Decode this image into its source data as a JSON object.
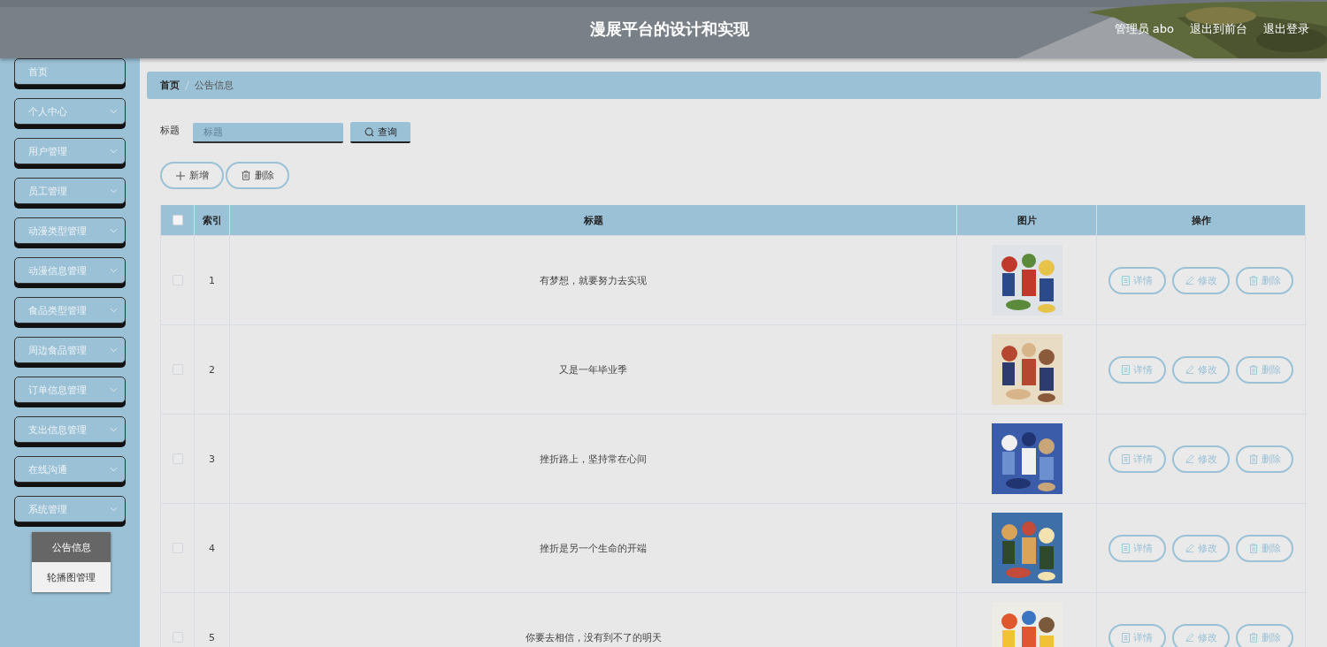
{
  "header": {
    "title": "漫展平台的设计和实现",
    "links": [
      "管理员 abo",
      "退出到前台",
      "退出登录"
    ]
  },
  "sidebar": {
    "items": [
      {
        "label": "首页",
        "kind": "link"
      },
      {
        "label": "个人中心",
        "kind": "group"
      },
      {
        "label": "用户管理",
        "kind": "group"
      },
      {
        "label": "员工管理",
        "kind": "group"
      },
      {
        "label": "动漫类型管理",
        "kind": "group"
      },
      {
        "label": "动漫信息管理",
        "kind": "group"
      },
      {
        "label": "食品类型管理",
        "kind": "group"
      },
      {
        "label": "周边食品管理",
        "kind": "group"
      },
      {
        "label": "订单信息管理",
        "kind": "group"
      },
      {
        "label": "支出信息管理",
        "kind": "group"
      },
      {
        "label": "在线沟通",
        "kind": "group"
      },
      {
        "label": "系统管理",
        "kind": "group",
        "children": [
          {
            "label": "公告信息",
            "selected": true
          },
          {
            "label": "轮播图管理",
            "selected": false
          }
        ]
      }
    ]
  },
  "breadcrumb": [
    "首页",
    "公告信息"
  ],
  "search": {
    "label": "标题",
    "placeholder": "标题",
    "button": "查询"
  },
  "actions": [
    "新增",
    "删除"
  ],
  "table": {
    "select_all_checked": false,
    "columns": [
      "索引",
      "标题",
      "图片",
      "操作"
    ],
    "rows": [
      {
        "checked": false,
        "index": "1",
        "title": "有梦想，就要努力去实现",
        "actions": [
          "详情",
          "修改",
          "删除"
        ]
      },
      {
        "checked": false,
        "index": "2",
        "title": "又是一年毕业季",
        "actions": [
          "详情",
          "修改",
          "删除"
        ]
      },
      {
        "checked": false,
        "index": "3",
        "title": "挫折路上，坚持常在心间",
        "actions": [
          "详情",
          "修改",
          "删除"
        ]
      },
      {
        "checked": false,
        "index": "4",
        "title": "挫折是另一个生命的开端",
        "actions": [
          "详情",
          "修改",
          "删除"
        ]
      },
      {
        "checked": false,
        "index": "5",
        "title": "你要去相信，没有到不了的明天",
        "actions": [
          "详情",
          "修改",
          "删除"
        ]
      }
    ]
  }
}
